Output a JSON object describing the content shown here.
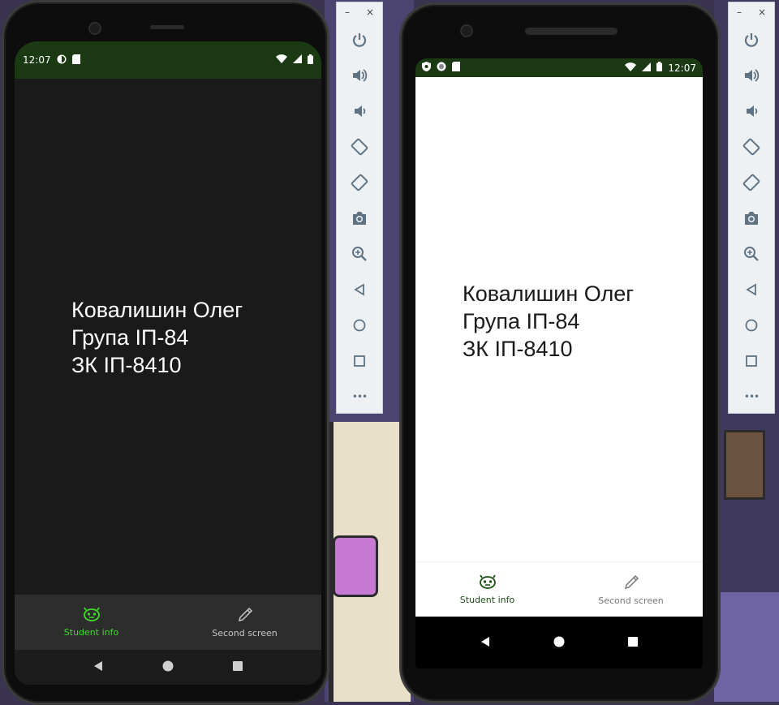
{
  "left_phone": {
    "status_time": "12:07",
    "student": {
      "name": "Ковалишин Олег",
      "group": "Група ІП-84",
      "record": "ЗК ІП-8410"
    },
    "nav": {
      "student_info": "Student info",
      "second_screen": "Second screen"
    }
  },
  "right_phone": {
    "status_time": "12:07",
    "student": {
      "name": "Ковалишин Олег",
      "group": "Група ІП-84",
      "record": "ЗК ІП-8410"
    },
    "nav": {
      "student_info": "Student info",
      "second_screen": "Second screen"
    }
  },
  "toolbar": {
    "minimize": "–",
    "close": "×",
    "more": "•••",
    "buttons": [
      "power-icon",
      "volume-up-icon",
      "volume-down-icon",
      "rotate-left-icon",
      "rotate-right-icon",
      "camera-icon",
      "zoom-icon",
      "back-icon",
      "home-icon",
      "overview-icon",
      "more-icon"
    ]
  },
  "colors": {
    "statusbar": "#1b3a14",
    "accent_dark": "#3fdc2a",
    "accent_light": "#1b4d14",
    "toolbar_icon": "#5f7383"
  }
}
